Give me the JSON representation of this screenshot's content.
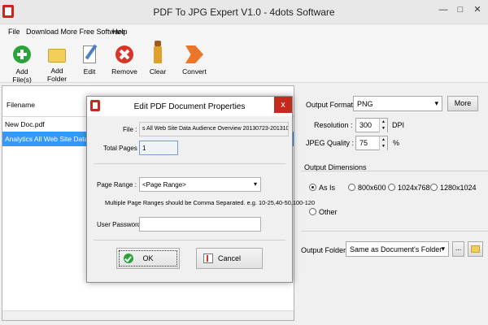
{
  "window": {
    "title": "PDF To JPG Expert V1.0 - 4dots Software",
    "min_icon": "—",
    "max_icon": "□",
    "close_icon": "✕"
  },
  "menu": [
    "File",
    "Download More Free Software",
    "Help"
  ],
  "toolbar": {
    "add_files": "Add File(s)",
    "add_folder": "Add Folder",
    "edit": "Edit",
    "remove": "Remove",
    "clear": "Clear",
    "convert": "Convert"
  },
  "filelist": {
    "header": "Filename",
    "rows": [
      "New Doc.pdf",
      "Analytics All Web Site Data Audience"
    ]
  },
  "options": {
    "output_format_label": "Output Format :",
    "output_format_value": "PNG",
    "more_label": "More",
    "resolution_label": "Resolution :",
    "resolution_value": "300",
    "resolution_unit": "DPI",
    "jpeg_quality_label": "JPEG Quality :",
    "jpeg_quality_value": "75",
    "jpeg_quality_unit": "%",
    "dimensions_label": "Output Dimensions",
    "dim_as_is": "As Is",
    "dim_800": "800x600",
    "dim_1024": "1024x768",
    "dim_1280": "1280x1024",
    "dim_other": "Other",
    "output_folder_label": "Output Folder :",
    "output_folder_value": "Same as Document's Folder",
    "browse_label": "..."
  },
  "dialog": {
    "title": "Edit PDF Document Properties",
    "file_label": "File :",
    "file_value": "s All Web Site Data Audience Overview 20130723-20131004.pdf",
    "total_pages_label": "Total Pages :",
    "total_pages_value": "1",
    "page_range_label": "Page Range :",
    "page_range_value": "<Page Range>",
    "page_range_hint": "Multiple Page Ranges should be Comma Separated. e.g. 10-25,40-50,100-120",
    "password_label": "User Password :",
    "password_value": "",
    "ok_label": "OK",
    "cancel_label": "Cancel",
    "close_icon": "x"
  },
  "colors": {
    "selection": "#3399ff",
    "close_red": "#c42b1c",
    "app_red": "#c8261e"
  }
}
